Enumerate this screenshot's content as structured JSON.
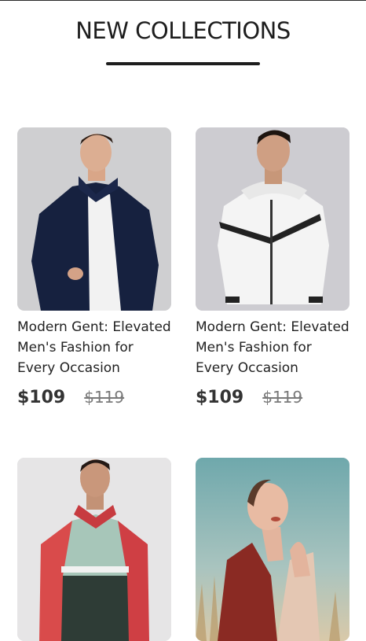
{
  "section": {
    "title": "NEW COLLECTIONS"
  },
  "products": [
    {
      "name": "Modern Gent: Elevated Men's Fashion for Every Occasion",
      "price": "$109",
      "old_price": "$119",
      "image": "man-navy-jacket"
    },
    {
      "name": "Modern Gent: Elevated Men's Fashion for Every Occasion",
      "price": "$109",
      "old_price": "$119",
      "image": "man-white-jacket"
    },
    {
      "image": "man-red-jacket"
    },
    {
      "image": "woman-red-top"
    }
  ]
}
